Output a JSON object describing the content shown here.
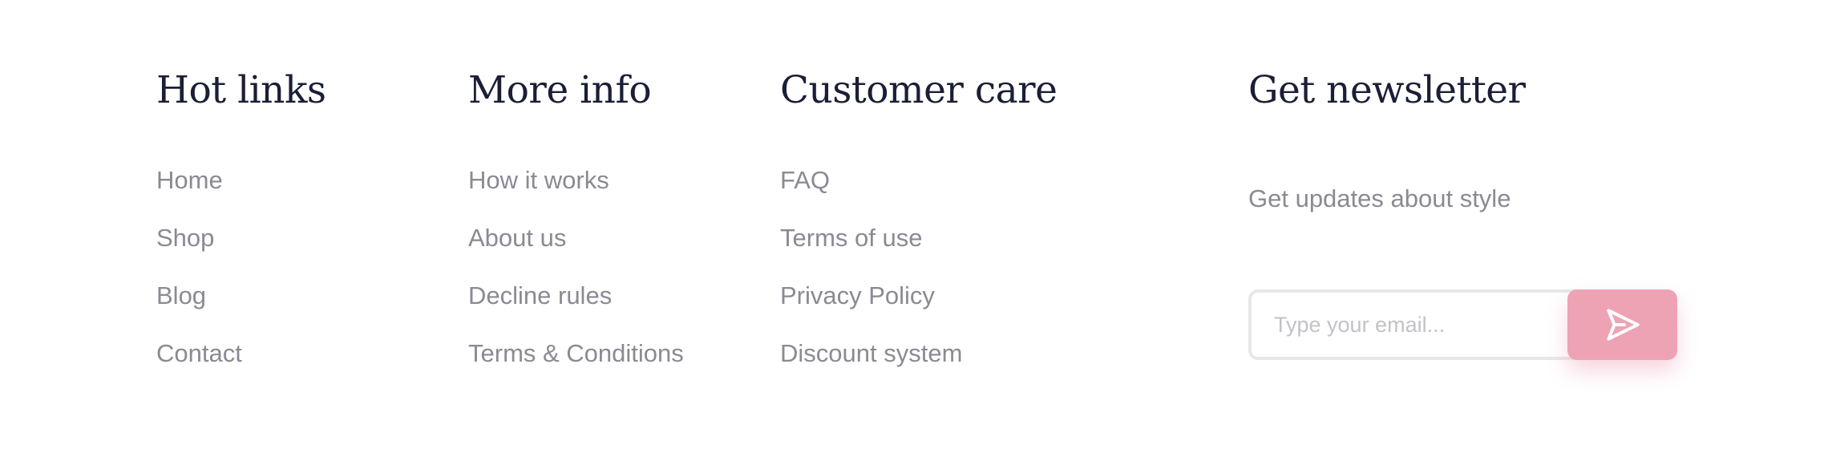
{
  "footer": {
    "hot_links": {
      "title": "Hot links",
      "items": [
        {
          "label": "Home"
        },
        {
          "label": "Shop"
        },
        {
          "label": "Blog"
        },
        {
          "label": "Contact"
        }
      ]
    },
    "more_info": {
      "title": "More info",
      "items": [
        {
          "label": "How it works"
        },
        {
          "label": "About us"
        },
        {
          "label": "Decline rules"
        },
        {
          "label": "Terms & Conditions"
        }
      ]
    },
    "customer_care": {
      "title": "Customer care",
      "items": [
        {
          "label": "FAQ"
        },
        {
          "label": "Terms of use"
        },
        {
          "label": "Privacy Policy"
        },
        {
          "label": "Discount system"
        }
      ]
    },
    "newsletter": {
      "title": "Get newsletter",
      "description": "Get updates about style",
      "email_placeholder": "Type your email...",
      "email_value": "",
      "send_icon": "send-icon"
    }
  },
  "colors": {
    "heading": "#1a1f36",
    "link": "#8a8a94",
    "accent": "#eea3b5",
    "input_border": "#e7e7ea",
    "placeholder": "#c2c2c7",
    "background": "#ffffff"
  }
}
